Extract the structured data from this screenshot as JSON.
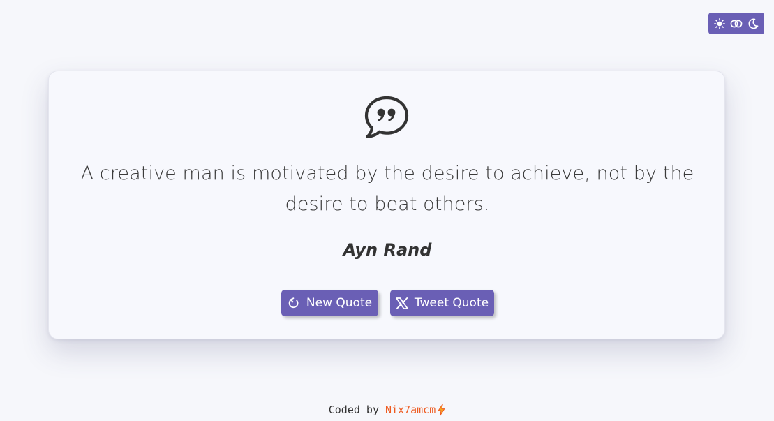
{
  "theme_toggle": {
    "icons": [
      "sun-icon",
      "contrast-toggle-icon",
      "moon-icon"
    ],
    "background_color": "#6a5fb5"
  },
  "quote": {
    "icon": "quote-bubble-icon",
    "text": "A creative man is motivated by the desire to achieve, not by the desire to beat others.",
    "author": "Ayn Rand"
  },
  "actions": {
    "new_quote": {
      "label": "New Quote",
      "icon": "refresh-icon"
    },
    "tweet_quote": {
      "label": "Tweet Quote",
      "icon": "x-logo-icon"
    }
  },
  "footer": {
    "prefix": "Coded by",
    "author_link": "Nix7amcm",
    "icon": "lightning-bolt-icon",
    "link_color": "#ee5a1f"
  },
  "colors": {
    "accent": "#6a5fb5",
    "background": "#f6f7fb",
    "text": "#333333"
  }
}
